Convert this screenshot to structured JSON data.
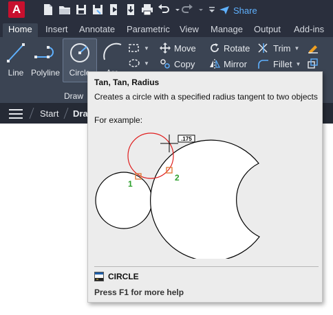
{
  "app": {
    "logo_letter": "A"
  },
  "quick_access": {
    "icons": [
      "new-file-icon",
      "open-folder-icon",
      "save-icon",
      "save-as-icon",
      "open-web-icon",
      "save-web-icon",
      "plot-icon",
      "undo-icon",
      "redo-icon",
      "customize-caret-icon"
    ],
    "share_label": "Share"
  },
  "tabs": [
    "Home",
    "Insert",
    "Annotate",
    "Parametric",
    "View",
    "Manage",
    "Output",
    "Add-ins"
  ],
  "ribbon": {
    "draw_tools": [
      "Line",
      "Polyline",
      "Circle",
      "Arc"
    ],
    "modify_tools": [
      "Move",
      "Rotate",
      "Trim",
      "Copy",
      "Mirror",
      "Fillet"
    ],
    "panel_label": "Draw"
  },
  "file_tabs": [
    "Start",
    "Draw"
  ],
  "tooltip": {
    "title": "Tan, Tan, Radius",
    "description": "Creates a circle with a specified radius tangent to two objects",
    "example_label": "For example:",
    "figure": {
      "radius_value": ".175",
      "tangent_point_1": "1",
      "tangent_point_2": "2"
    },
    "command_name": "CIRCLE",
    "help_text": "Press F1 for more help"
  },
  "colors": {
    "titlebar": "#2a2f3d",
    "ribbon": "#3b4453",
    "accent_blue": "#5fb1ff",
    "logo_red": "#c8102e",
    "tangent_circle": "#e01e1e",
    "tangent_marker": "#e07a3a",
    "point_label_green": "#2ca02c"
  }
}
